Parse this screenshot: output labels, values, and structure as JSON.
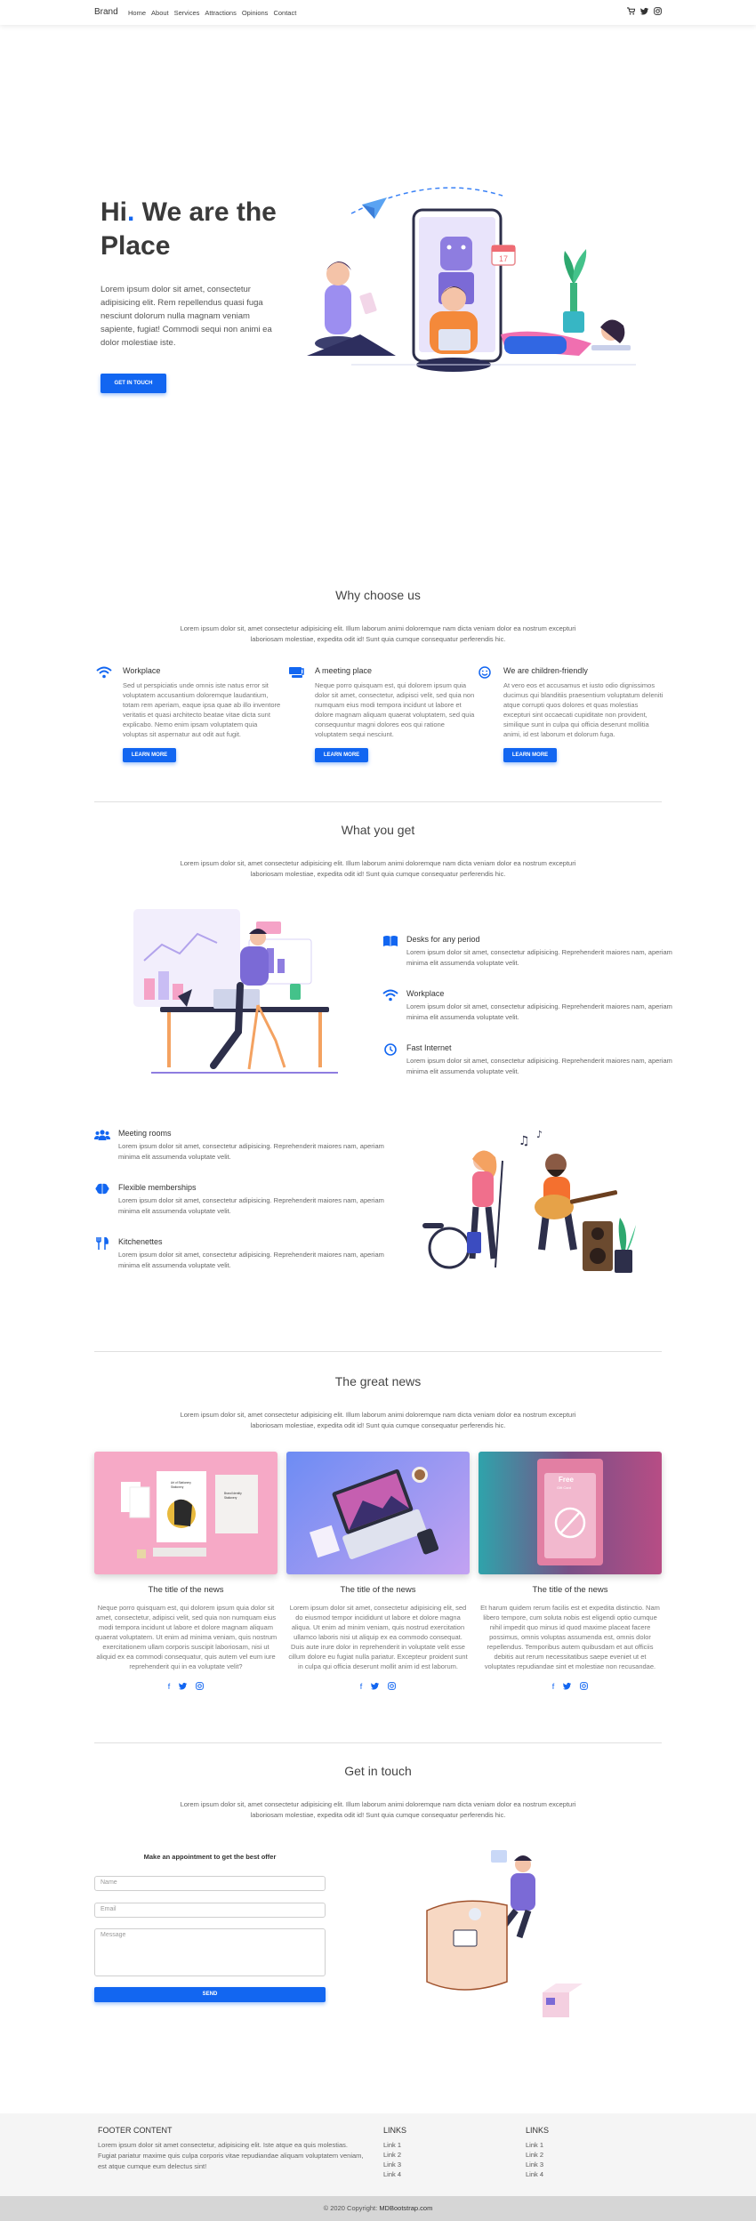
{
  "nav": {
    "brand": "Brand",
    "links": [
      "Home",
      "About",
      "Services",
      "Attractions",
      "Opinions",
      "Contact"
    ],
    "icons": [
      "cart-icon",
      "twitter-icon",
      "instagram-icon"
    ]
  },
  "hero": {
    "title_part1": "Hi",
    "title_dot": ".",
    "title_part2": " We are the Place",
    "text": "Lorem ipsum dolor sit amet, consectetur adipisicing elit. Rem repellendus quasi fuga nesciunt dolorum nulla magnam veniam sapiente, fugiat! Commodi sequi non animi ea dolor molestiae iste.",
    "button": "Get in touch"
  },
  "why": {
    "title": "Why choose us",
    "subtitle": "Lorem ipsum dolor sit, amet consectetur adipisicing elit. Illum laborum animi doloremque nam dicta veniam dolor ea nostrum excepturi laboriosam molestiae, expedita odit id! Sunt quia cumque consequatur perferendis hic.",
    "features": [
      {
        "title": "Workplace",
        "icon": "wifi-icon",
        "text": "Sed ut perspiciatis unde omnis iste natus error sit voluptatem accusantium doloremque laudantium, totam rem aperiam, eaque ipsa quae ab illo inventore veritatis et quasi architecto beatae vitae dicta sunt explicabo. Nemo enim ipsam voluptatem quia voluptas sit aspernatur aut odit aut fugit.",
        "button": "Learn more"
      },
      {
        "title": "A meeting place",
        "icon": "meeting-icon",
        "text": "Neque porro quisquam est, qui dolorem ipsum quia dolor sit amet, consectetur, adipisci velit, sed quia non numquam eius modi tempora incidunt ut labore et dolore magnam aliquam quaerat voluptatem, sed quia consequuntur magni dolores eos qui ratione voluptatem sequi nesciunt.",
        "button": "Learn more"
      },
      {
        "title": "We are children-friendly",
        "icon": "smile-icon",
        "text": "At vero eos et accusamus et iusto odio dignissimos ducimus qui blanditiis praesentium voluptatum deleniti atque corrupti quos dolores et quas molestias excepturi sint occaecati cupiditate non provident, similique sunt in culpa qui officia deserunt mollitia animi, id est laborum et dolorum fuga.",
        "button": "Learn more"
      }
    ]
  },
  "get": {
    "title": "What you get",
    "subtitle": "Lorem ipsum dolor sit, amet consectetur adipisicing elit. Illum laborum animi doloremque nam dicta veniam dolor ea nostrum excepturi laboriosam molestiae, expedita odit id! Sunt quia cumque consequatur perferendis hic.",
    "list_right": [
      {
        "title": "Desks for any period",
        "icon": "book-icon",
        "text": "Lorem ipsum dolor sit amet, consectetur adipisicing. Reprehenderit maiores nam, aperiam minima elit assumenda voluptate velit."
      },
      {
        "title": "Workplace",
        "icon": "wifi-icon",
        "text": "Lorem ipsum dolor sit amet, consectetur adipisicing. Reprehenderit maiores nam, aperiam minima elit assumenda voluptate velit."
      },
      {
        "title": "Fast Internet",
        "icon": "clock-icon",
        "text": "Lorem ipsum dolor sit amet, consectetur adipisicing. Reprehenderit maiores nam, aperiam minima elit assumenda voluptate velit."
      }
    ],
    "list_left": [
      {
        "title": "Meeting rooms",
        "icon": "users-icon",
        "text": "Lorem ipsum dolor sit amet, consectetur adipisicing. Reprehenderit maiores nam, aperiam minima elit assumenda voluptate velit."
      },
      {
        "title": "Flexible memberships",
        "icon": "brain-icon",
        "text": "Lorem ipsum dolor sit amet, consectetur adipisicing. Reprehenderit maiores nam, aperiam minima elit assumenda voluptate velit."
      },
      {
        "title": "Kitchenettes",
        "icon": "utensils-icon",
        "text": "Lorem ipsum dolor sit amet, consectetur adipisicing. Reprehenderit maiores nam, aperiam minima elit assumenda voluptate velit."
      }
    ]
  },
  "news": {
    "title": "The great news",
    "subtitle": "Lorem ipsum dolor sit, amet consectetur adipisicing elit. Illum laborum animi doloremque nam dicta veniam dolor ea nostrum excepturi laboriosam molestiae, expedita odit id! Sunt quia cumque consequatur perferendis hic.",
    "cards": [
      {
        "title": "The title of the news",
        "text": "Neque porro quisquam est, qui dolorem ipsum quia dolor sit amet, consectetur, adipisci velit, sed quia non numquam eius modi tempora incidunt ut labore et dolore magnam aliquam quaerat voluptatem. Ut enim ad minima veniam, quis nostrum exercitationem ullam corporis suscipit laboriosam, nisi ut aliquid ex ea commodi consequatur, quis autem vel eum iure reprehenderit qui in ea voluptate velit?",
        "image": "Stationery mockup",
        "image_words": [
          "Art of Stationery",
          "Stationery",
          "Brand Identity",
          "Stationery"
        ]
      },
      {
        "title": "The title of the news",
        "text": "Lorem ipsum dolor sit amet, consectetur adipisicing elit, sed do eiusmod tempor incididunt ut labore et dolore magna aliqua. Ut enim ad minim veniam, quis nostrud exercitation ullamco laboris nisi ut aliquip ex ea commodo consequat. Duis aute irure dolor in reprehenderit in voluptate velit esse cillum dolore eu fugiat nulla pariatur. Excepteur proident sunt in culpa qui officia deserunt mollit anim id est laborum.",
        "image": "Laptop workspace"
      },
      {
        "title": "The title of the news",
        "text": "Et harum quidem rerum facilis est et expedita distinctio. Nam libero tempore, cum soluta nobis est eligendi optio cumque nihil impedit quo minus id quod maxime placeat facere possimus, omnis voluptas assumenda est, omnis dolor repellendus. Temporibus autem quibusdam et aut officiis debitis aut rerum necessitatibus saepe eveniet ut et voluptates repudiandae sint et molestiae non recusandae.",
        "image": "Gift card",
        "image_words": [
          "Free",
          "Gift Card"
        ]
      }
    ],
    "social": [
      "facebook-icon",
      "twitter-icon",
      "instagram-icon"
    ]
  },
  "contact": {
    "title": "Get in touch",
    "subtitle": "Lorem ipsum dolor sit, amet consectetur adipisicing elit. Illum laborum animi doloremque nam dicta veniam dolor ea nostrum excepturi laboriosam molestiae, expedita odit id! Sunt quia cumque consequatur perferendis hic.",
    "form_heading": "Make an appointment to get the best offer",
    "name_placeholder": "Name",
    "email_placeholder": "Email",
    "message_placeholder": "Message",
    "send": "Send"
  },
  "footer": {
    "content_title": "Footer Content",
    "content_text": "Lorem ipsum dolor sit amet consectetur, adipisicing elit. Iste atque ea quis molestias. Fugiat pariatur maxime quis culpa corporis vitae repudiandae aliquam voluptatem veniam, est atque cumque eum delectus sint!",
    "links1_title": "Links",
    "links1": [
      "Link 1",
      "Link 2",
      "Link 3",
      "Link 4"
    ],
    "links2_title": "Links",
    "links2": [
      "Link 1",
      "Link 2",
      "Link 3",
      "Link 4"
    ],
    "copyright_prefix": "© 2020 Copyright:",
    "copyright_site": "MDBootstrap.com"
  },
  "colors": {
    "primary": "#1266f1",
    "footer_bg": "#f5f5f5",
    "copyright_bg": "#d6d6d6"
  }
}
